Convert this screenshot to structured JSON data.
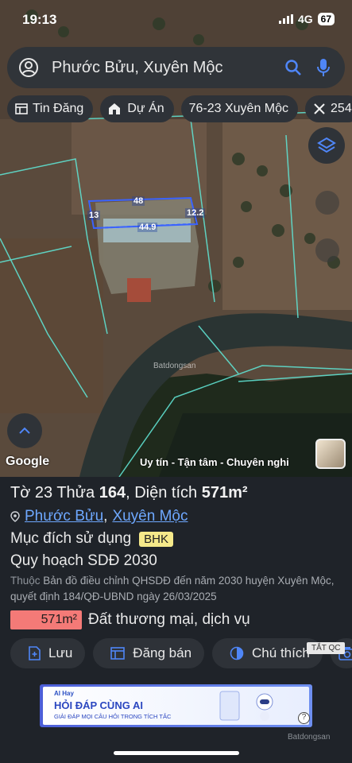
{
  "status": {
    "time": "19:13",
    "network": "4G",
    "battery": "67"
  },
  "search": {
    "query": "Phước Bửu, Xuyên Mộc"
  },
  "chips": [
    {
      "label": "Tin Đăng",
      "icon": "listing-icon"
    },
    {
      "label": "Dự Án",
      "icon": "house-icon"
    },
    {
      "label": "76-23 Xuyên Mộc",
      "icon": ""
    },
    {
      "label": "254",
      "icon": "ruler-icon"
    }
  ],
  "map": {
    "dimensions": {
      "top": "48",
      "left": "13",
      "right": "12.2",
      "bottom": "44.9"
    },
    "watermark": "Batdongsan",
    "google": "Google",
    "slogan": "Uy tín - Tận tâm - Chuyên nghi"
  },
  "parcel": {
    "sheet_label": "Tờ 23 Thửa",
    "parcel_no": "164",
    "area_label": ", Diện tích",
    "area": "571m²",
    "ward": "Phước Bửu",
    "separator": ",",
    "district": "Xuyên Mộc",
    "purpose_label": "Mục đích sử dụng",
    "purpose_code": "BHK",
    "plan_title": "Quy hoạch SDĐ 2030",
    "plan_prefix": "Thuộc",
    "plan_desc": "Bản đồ điều chỉnh QHSDĐ đến năm 2030 huyện Xuyên Mộc, quyết định 184/QĐ-UBND ngày 26/03/2025",
    "zone_area": "571m²",
    "zone_label": "Đất thương mại, dịch vụ",
    "zone_color": "#f47a77"
  },
  "actions": [
    {
      "label": "Lưu",
      "icon": "save-icon"
    },
    {
      "label": "Đăng bán",
      "icon": "listing-icon"
    },
    {
      "label": "Chú thích",
      "icon": "legend-icon"
    },
    {
      "label": "",
      "icon": "camera-icon"
    }
  ],
  "ad": {
    "close_label": "TẮT QC",
    "brand": "AI Hay",
    "title": "HỎI ĐÁP CÙNG AI",
    "subtitle": "GIẢI ĐÁP MỌI CÂU HỎI TRONG TÍCH TẮC",
    "help": "?"
  },
  "footer_brand": "Batdongsan"
}
